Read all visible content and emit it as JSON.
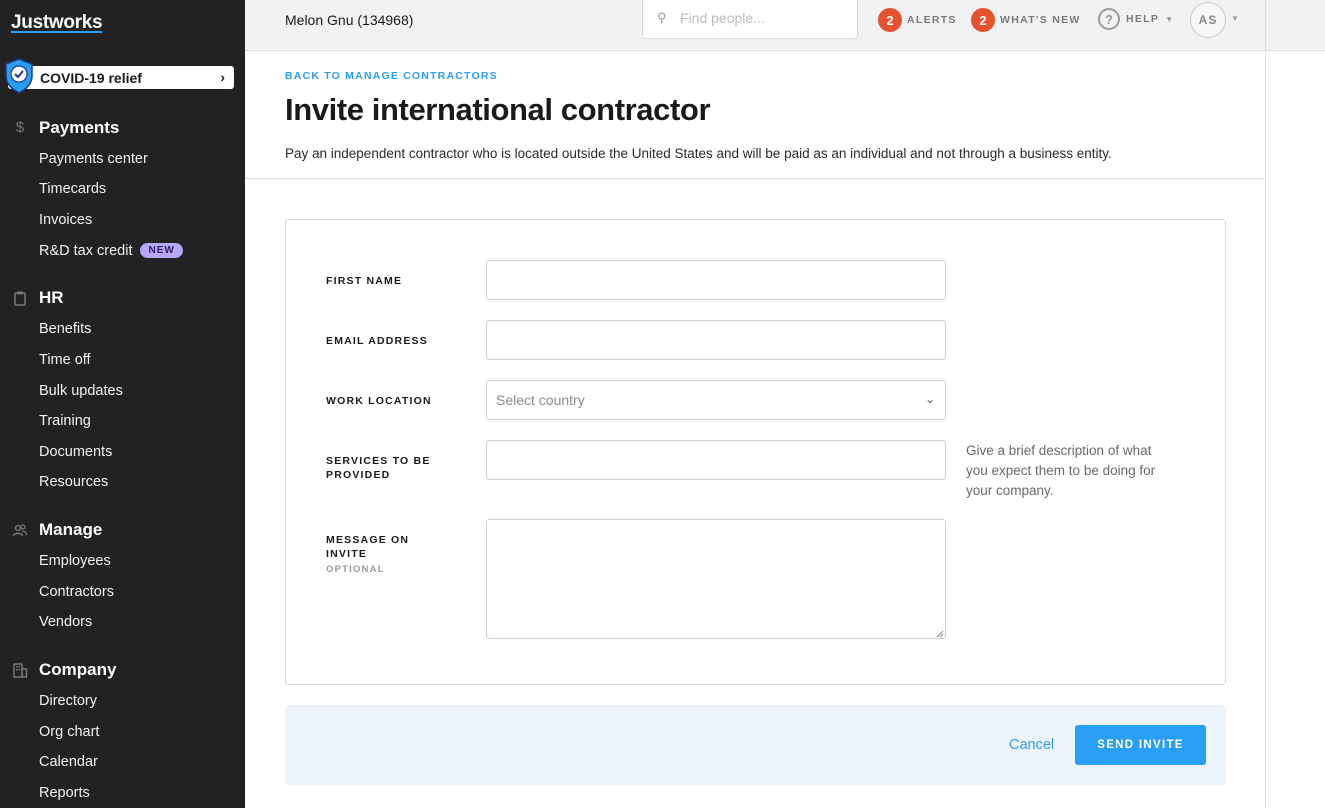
{
  "sidebar": {
    "logo": "Justworks",
    "covid": {
      "label": "COVID-19 relief",
      "icon": "shield-check-icon"
    },
    "sections": [
      {
        "title": "Payments",
        "icon": "dollar-icon",
        "items": [
          "Payments center",
          "Timecards",
          "Invoices",
          "R&D tax credit"
        ]
      },
      {
        "title": "HR",
        "icon": "clipboard-icon",
        "items": [
          "Benefits",
          "Time off",
          "Bulk updates",
          "Training",
          "Documents",
          "Resources"
        ]
      },
      {
        "title": "Manage",
        "icon": "people-icon",
        "items": [
          "Employees",
          "Contractors",
          "Vendors"
        ]
      },
      {
        "title": "Company",
        "icon": "building-icon",
        "items": [
          "Directory",
          "Org chart",
          "Calendar",
          "Reports"
        ]
      }
    ],
    "new_badge": "NEW"
  },
  "topbar": {
    "company": "Melon Gnu (134968)",
    "search_placeholder": "Find people...",
    "alerts_count": "2",
    "alerts_label": "ALERTS",
    "whats_new_count": "2",
    "whats_new_label": "WHAT'S NEW",
    "help_label": "HELP",
    "avatar_initials": "AS"
  },
  "header": {
    "back_link": "BACK TO MANAGE CONTRACTORS",
    "title": "Invite international contractor",
    "description": "Pay an independent contractor who is located outside the United States and will be paid as an individual and not through a business entity."
  },
  "form": {
    "first_name_label": "FIRST NAME",
    "first_name_value": "",
    "email_label": "EMAIL ADDRESS",
    "email_value": "",
    "work_location_label": "WORK LOCATION",
    "work_location_placeholder": "Select country",
    "services_label": "SERVICES TO BE PROVIDED",
    "services_value": "",
    "services_hint": "Give a brief description of what you expect them to be doing for your company.",
    "message_label": "MESSAGE ON INVITE",
    "message_optional": "OPTIONAL",
    "message_value": ""
  },
  "footer": {
    "cancel_label": "Cancel",
    "send_label": "SEND INVITE"
  },
  "colors": {
    "accent": "#2a9df4",
    "sidebar_bg": "#222222",
    "alert_badge": "#e5532e",
    "new_badge": "#b7a6f5",
    "footer_bg": "#eef4fc"
  }
}
